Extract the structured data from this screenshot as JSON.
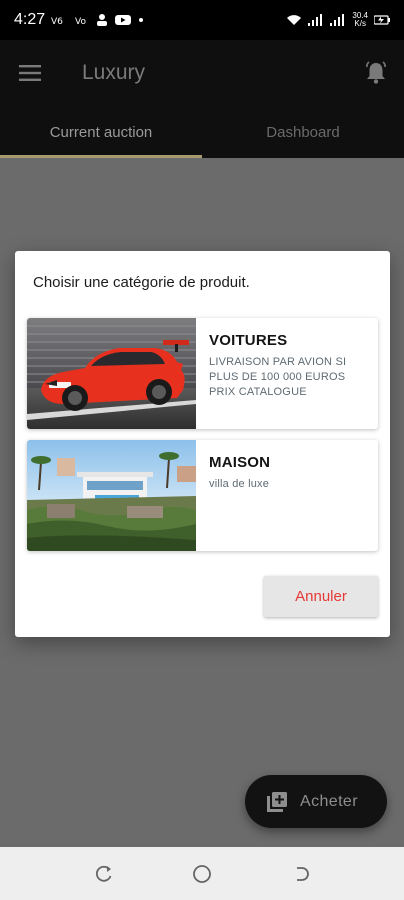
{
  "status_bar": {
    "time": "4:27",
    "icons": [
      "volte-icon",
      "vo-wifi-icon",
      "person-icon",
      "youtube-icon",
      "dot-icon"
    ],
    "network_speed_value": "30.4",
    "network_speed_unit": "K/s"
  },
  "app_bar": {
    "title": "Luxury",
    "title_color": "#7a7a7a"
  },
  "tabs": [
    {
      "label": "Current auction",
      "active": true
    },
    {
      "label": "Dashboard",
      "active": false
    }
  ],
  "dialog": {
    "title": "Choisir une catégorie de produit.",
    "items": [
      {
        "name": "VOITURES",
        "description": "LIVRAISON PAR AVION SI PLUS DE 100 000 EUROS PRIX CATALOGUE",
        "image": "red-sports-car-image"
      },
      {
        "name": "MAISON",
        "description": "villa de luxe",
        "image": "luxury-villa-image"
      }
    ],
    "cancel_label": "Annuler",
    "cancel_color": "#e53935"
  },
  "fab": {
    "label": "Acheter",
    "icon": "add-to-queue-icon"
  },
  "colors": {
    "accent": "#a79a70",
    "scrim": "#6b6b6b",
    "app_bar": "#0f0f0f"
  }
}
